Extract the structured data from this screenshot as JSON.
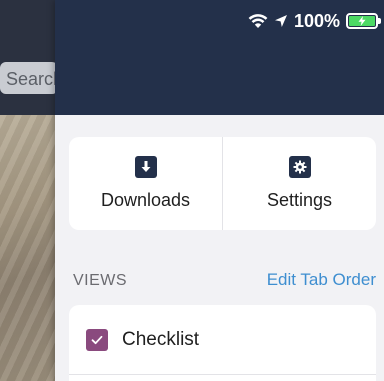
{
  "background": {
    "search_placeholder": "Search"
  },
  "status_bar": {
    "battery_percent": "100%",
    "icons": [
      "wifi-icon",
      "location-arrow-icon",
      "battery-charging-icon"
    ]
  },
  "actions": [
    {
      "label": "Downloads",
      "icon": "download-icon"
    },
    {
      "label": "Settings",
      "icon": "gear-icon"
    }
  ],
  "views": {
    "section_title": "VIEWS",
    "edit_label": "Edit Tab Order",
    "items": [
      {
        "label": "Checklist",
        "checked": true,
        "icon": "checkmark-icon"
      }
    ]
  },
  "colors": {
    "header": "#23304a",
    "accent_link": "#3e8ed0",
    "checkbox": "#8a4a7e",
    "battery": "#4cd964"
  }
}
